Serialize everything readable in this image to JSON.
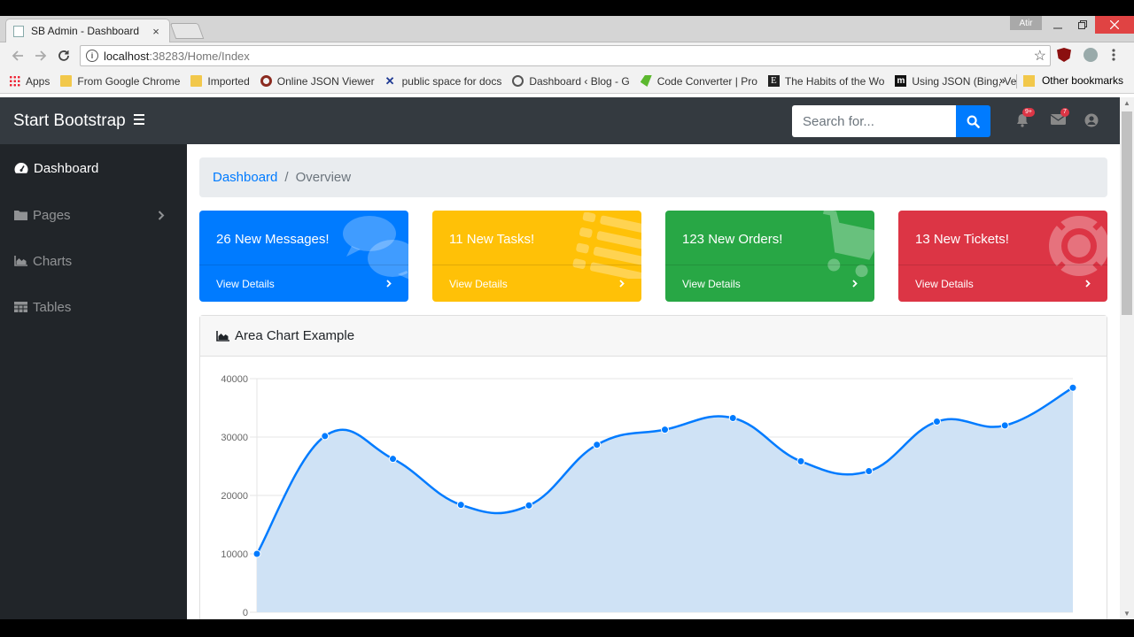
{
  "browser": {
    "tab_title": "SB Admin - Dashboard",
    "tab_close": "×",
    "user_label": "Atir",
    "url_host": "localhost",
    "url_path": ":38283/Home/Index",
    "bookmarks": [
      {
        "label": "Apps",
        "icon": "apps-grid-icon"
      },
      {
        "label": "From Google Chrome",
        "icon": "folder-icon"
      },
      {
        "label": "Imported",
        "icon": "folder-icon"
      },
      {
        "label": "Online JSON Viewer",
        "icon": "json-viewer-icon"
      },
      {
        "label": "public space for docs",
        "icon": "confluence-icon"
      },
      {
        "label": "Dashboard ‹ Blog - G",
        "icon": "wordpress-icon"
      },
      {
        "label": "Code Converter | Pro",
        "icon": "code-converter-icon"
      },
      {
        "label": "The Habits of the Wo",
        "icon": "e-icon"
      },
      {
        "label": "Using JSON (Bing, Ve",
        "icon": "m-icon"
      }
    ],
    "bookmarks_more": "»",
    "other_bookmarks": "Other bookmarks"
  },
  "navbar": {
    "brand": "Start Bootstrap",
    "search_placeholder": "Search for...",
    "alerts_badge": "9+",
    "messages_badge": "7"
  },
  "sidebar": {
    "items": [
      {
        "label": "Dashboard",
        "icon": "tachometer-icon",
        "active": true
      },
      {
        "label": "Pages",
        "icon": "folder-icon"
      },
      {
        "label": "Charts",
        "icon": "area-chart-icon"
      },
      {
        "label": "Tables",
        "icon": "table-icon"
      }
    ]
  },
  "breadcrumb": {
    "link": "Dashboard",
    "separator": "/",
    "current": "Overview"
  },
  "cards": [
    {
      "title": "26 New Messages!",
      "footer": "View Details",
      "color": "#007bff",
      "icon": "comments-icon"
    },
    {
      "title": "11 New Tasks!",
      "footer": "View Details",
      "color": "#ffc107",
      "icon": "list-icon"
    },
    {
      "title": "123 New Orders!",
      "footer": "View Details",
      "color": "#28a745",
      "icon": "shopping-cart-icon"
    },
    {
      "title": "13 New Tickets!",
      "footer": "View Details",
      "color": "#dc3545",
      "icon": "support-icon"
    }
  ],
  "area_chart": {
    "title": "Area Chart Example"
  },
  "chart_data": {
    "type": "area",
    "y": [
      10000,
      30162,
      26263,
      18394,
      18287,
      28682,
      31274,
      33259,
      25849,
      24159,
      32651,
      31984,
      38451
    ],
    "ylim": [
      0,
      40000
    ],
    "yticks": [
      0,
      10000,
      20000,
      30000,
      40000
    ],
    "grid": true,
    "line_color": "#007bff",
    "fill_color": "#cfe2f5"
  }
}
